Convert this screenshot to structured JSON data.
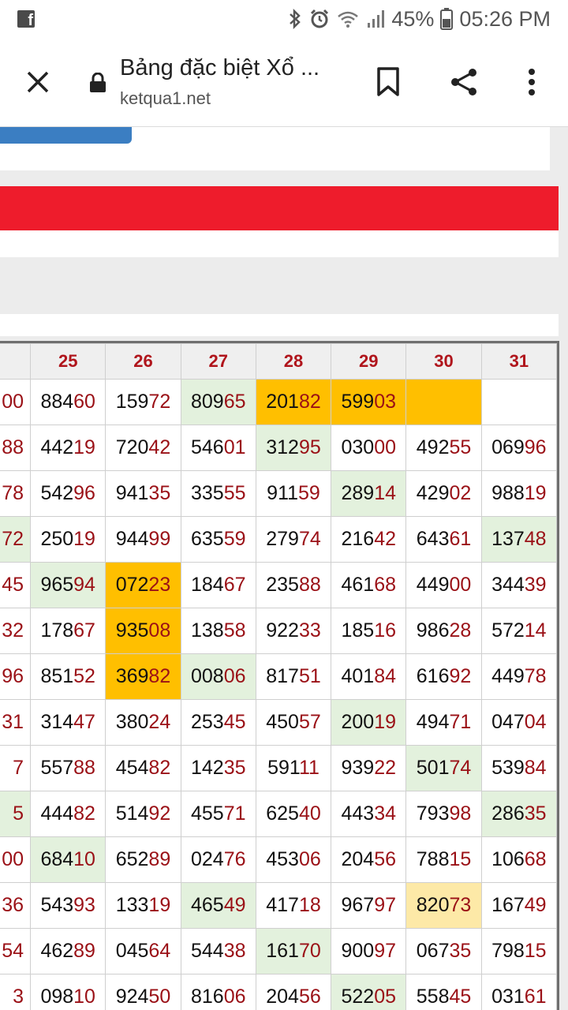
{
  "status": {
    "battery": "45%",
    "time": "05:26 PM"
  },
  "toolbar": {
    "title": "Bảng đặc biệt Xổ ...",
    "url": "ketqua1.net"
  },
  "colors": {
    "red_bar": "#ee1c2c",
    "button_blue": "#3b7ec2",
    "highlight_green": "#e3f1dd",
    "highlight_orange": "#ffbf00",
    "highlight_yellow": "#fde9a7",
    "tail_digits": "#9a1016"
  },
  "table": {
    "headers": [
      "",
      "25",
      "26",
      "27",
      "28",
      "29",
      "30",
      "31"
    ],
    "rows": [
      [
        {
          "v": "00",
          "h": ""
        },
        {
          "v": "88460",
          "h": ""
        },
        {
          "v": "15972",
          "h": ""
        },
        {
          "v": "80965",
          "h": "green"
        },
        {
          "v": "20182",
          "h": "orange"
        },
        {
          "v": "59903",
          "h": "orange"
        },
        {
          "v": "",
          "h": "orange"
        },
        {
          "v": "",
          "h": ""
        }
      ],
      [
        {
          "v": "88",
          "h": ""
        },
        {
          "v": "44219",
          "h": ""
        },
        {
          "v": "72042",
          "h": ""
        },
        {
          "v": "54601",
          "h": ""
        },
        {
          "v": "31295",
          "h": "green"
        },
        {
          "v": "03000",
          "h": ""
        },
        {
          "v": "49255",
          "h": ""
        },
        {
          "v": "06996",
          "h": ""
        }
      ],
      [
        {
          "v": "78",
          "h": ""
        },
        {
          "v": "54296",
          "h": ""
        },
        {
          "v": "94135",
          "h": ""
        },
        {
          "v": "33555",
          "h": ""
        },
        {
          "v": "91159",
          "h": ""
        },
        {
          "v": "28914",
          "h": "green"
        },
        {
          "v": "42902",
          "h": ""
        },
        {
          "v": "98819",
          "h": ""
        }
      ],
      [
        {
          "v": "72",
          "h": "green"
        },
        {
          "v": "25019",
          "h": ""
        },
        {
          "v": "94499",
          "h": ""
        },
        {
          "v": "63559",
          "h": ""
        },
        {
          "v": "27974",
          "h": ""
        },
        {
          "v": "21642",
          "h": ""
        },
        {
          "v": "64361",
          "h": ""
        },
        {
          "v": "13748",
          "h": "green"
        }
      ],
      [
        {
          "v": "45",
          "h": ""
        },
        {
          "v": "96594",
          "h": "green"
        },
        {
          "v": "07223",
          "h": "orange"
        },
        {
          "v": "18467",
          "h": ""
        },
        {
          "v": "23588",
          "h": ""
        },
        {
          "v": "46168",
          "h": ""
        },
        {
          "v": "44900",
          "h": ""
        },
        {
          "v": "34439",
          "h": ""
        }
      ],
      [
        {
          "v": "32",
          "h": ""
        },
        {
          "v": "17867",
          "h": ""
        },
        {
          "v": "93508",
          "h": "orange"
        },
        {
          "v": "13858",
          "h": ""
        },
        {
          "v": "92233",
          "h": ""
        },
        {
          "v": "18516",
          "h": ""
        },
        {
          "v": "98628",
          "h": ""
        },
        {
          "v": "57214",
          "h": ""
        }
      ],
      [
        {
          "v": "96",
          "h": ""
        },
        {
          "v": "85152",
          "h": ""
        },
        {
          "v": "36982",
          "h": "orange"
        },
        {
          "v": "00806",
          "h": "green"
        },
        {
          "v": "81751",
          "h": ""
        },
        {
          "v": "40184",
          "h": ""
        },
        {
          "v": "61692",
          "h": ""
        },
        {
          "v": "44978",
          "h": ""
        }
      ],
      [
        {
          "v": "31",
          "h": ""
        },
        {
          "v": "31447",
          "h": ""
        },
        {
          "v": "38024",
          "h": ""
        },
        {
          "v": "25345",
          "h": ""
        },
        {
          "v": "45057",
          "h": ""
        },
        {
          "v": "20019",
          "h": "green"
        },
        {
          "v": "49471",
          "h": ""
        },
        {
          "v": "04704",
          "h": ""
        }
      ],
      [
        {
          "v": "7",
          "h": ""
        },
        {
          "v": "55788",
          "h": ""
        },
        {
          "v": "45482",
          "h": ""
        },
        {
          "v": "14235",
          "h": ""
        },
        {
          "v": "59111",
          "h": ""
        },
        {
          "v": "93922",
          "h": ""
        },
        {
          "v": "50174",
          "h": "green"
        },
        {
          "v": "53984",
          "h": ""
        }
      ],
      [
        {
          "v": "5",
          "h": "green"
        },
        {
          "v": "44482",
          "h": ""
        },
        {
          "v": "51492",
          "h": ""
        },
        {
          "v": "45571",
          "h": ""
        },
        {
          "v": "62540",
          "h": ""
        },
        {
          "v": "44334",
          "h": ""
        },
        {
          "v": "79398",
          "h": ""
        },
        {
          "v": "28635",
          "h": "green"
        }
      ],
      [
        {
          "v": "00",
          "h": ""
        },
        {
          "v": "68410",
          "h": "green"
        },
        {
          "v": "65289",
          "h": ""
        },
        {
          "v": "02476",
          "h": ""
        },
        {
          "v": "45306",
          "h": ""
        },
        {
          "v": "20456",
          "h": ""
        },
        {
          "v": "78815",
          "h": ""
        },
        {
          "v": "10668",
          "h": ""
        }
      ],
      [
        {
          "v": "36",
          "h": ""
        },
        {
          "v": "54393",
          "h": ""
        },
        {
          "v": "13319",
          "h": ""
        },
        {
          "v": "46549",
          "h": "green"
        },
        {
          "v": "41718",
          "h": ""
        },
        {
          "v": "96797",
          "h": ""
        },
        {
          "v": "82073",
          "h": "yellow"
        },
        {
          "v": "16749",
          "h": ""
        }
      ],
      [
        {
          "v": "54",
          "h": ""
        },
        {
          "v": "46289",
          "h": ""
        },
        {
          "v": "04564",
          "h": ""
        },
        {
          "v": "54438",
          "h": ""
        },
        {
          "v": "16170",
          "h": "green"
        },
        {
          "v": "90097",
          "h": ""
        },
        {
          "v": "06735",
          "h": ""
        },
        {
          "v": "79815",
          "h": ""
        }
      ],
      [
        {
          "v": "3",
          "h": ""
        },
        {
          "v": "09810",
          "h": ""
        },
        {
          "v": "92450",
          "h": ""
        },
        {
          "v": "81606",
          "h": ""
        },
        {
          "v": "20456",
          "h": ""
        },
        {
          "v": "52205",
          "h": "green"
        },
        {
          "v": "55845",
          "h": ""
        },
        {
          "v": "03161",
          "h": ""
        }
      ]
    ]
  }
}
